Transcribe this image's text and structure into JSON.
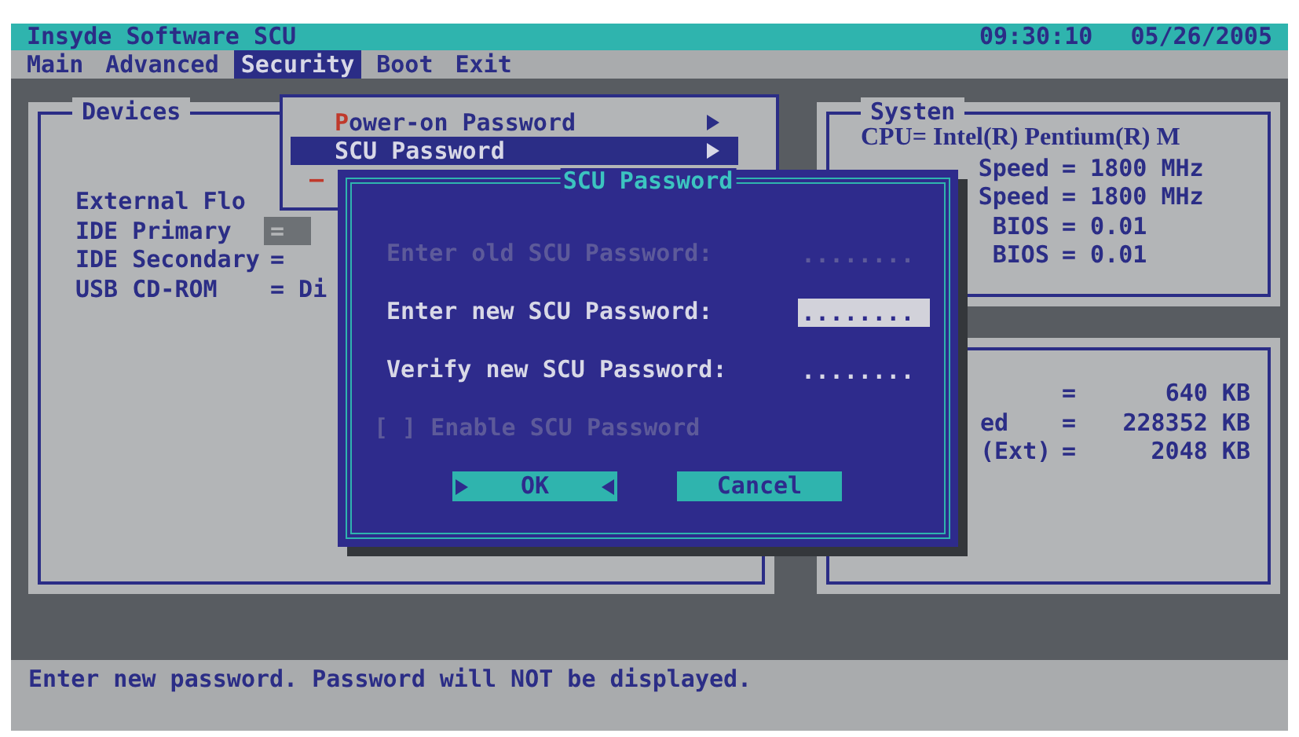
{
  "title_bar": {
    "title": "Insyde Software SCU",
    "time": "09:30:10",
    "date": "05/26/2005"
  },
  "menu": [
    {
      "label": "Main",
      "selected": false
    },
    {
      "label": "Advanced",
      "selected": false
    },
    {
      "label": "Security",
      "selected": true
    },
    {
      "label": "Boot",
      "selected": false
    },
    {
      "label": "Exit",
      "selected": false
    }
  ],
  "devices_panel": {
    "title": "Devices",
    "rows": [
      {
        "label": "External Flo"
      },
      {
        "label": "IDE Primary",
        "value": "=",
        "selected": true
      },
      {
        "label": "IDE Secondary",
        "value": "=",
        "selected": false
      },
      {
        "label": "USB CD-ROM",
        "value": "= Di",
        "selected": false
      }
    ]
  },
  "system_panel": {
    "title": "Systen",
    "cpu": "CPU= Intel(R) Pentium(R) M",
    "rows": [
      {
        "label": "Speed",
        "value": "= 1800 MHz"
      },
      {
        "label": "Speed",
        "value": "= 1800 MHz"
      },
      {
        "label": "BIOS",
        "value": "= 0.01"
      },
      {
        "label": "BIOS",
        "value": "= 0.01"
      }
    ]
  },
  "memory_panel": {
    "rows": [
      {
        "label": "",
        "value": "=",
        "amount": "640 KB"
      },
      {
        "label": "ed",
        "value": "=",
        "amount": "228352 KB"
      },
      {
        "label": "(Ext)",
        "value": "=",
        "amount": "2048 KB"
      }
    ]
  },
  "security_menu": {
    "items": [
      {
        "label": "Power-on Password",
        "submenu": true,
        "selected": false
      },
      {
        "label": "SCU Password",
        "submenu": true,
        "selected": true
      },
      {
        "label": "–",
        "submenu": false,
        "selected": false
      }
    ]
  },
  "dialog": {
    "title": "SCU Password",
    "fields": [
      {
        "label": "Enter old SCU Password:",
        "value": "........",
        "disabled": true,
        "selected": false
      },
      {
        "label": "Enter new SCU Password:",
        "value": "........",
        "disabled": false,
        "selected": true
      },
      {
        "label": "Verify new SCU Password:",
        "value": "........",
        "disabled": false,
        "selected": false
      }
    ],
    "checkbox": {
      "label": "[ ] Enable SCU Password",
      "disabled": true
    },
    "buttons": [
      {
        "label": "OK",
        "selected": true
      },
      {
        "label": "Cancel",
        "selected": false
      }
    ]
  },
  "status_bar": "Enter new password. Password will NOT be displayed."
}
